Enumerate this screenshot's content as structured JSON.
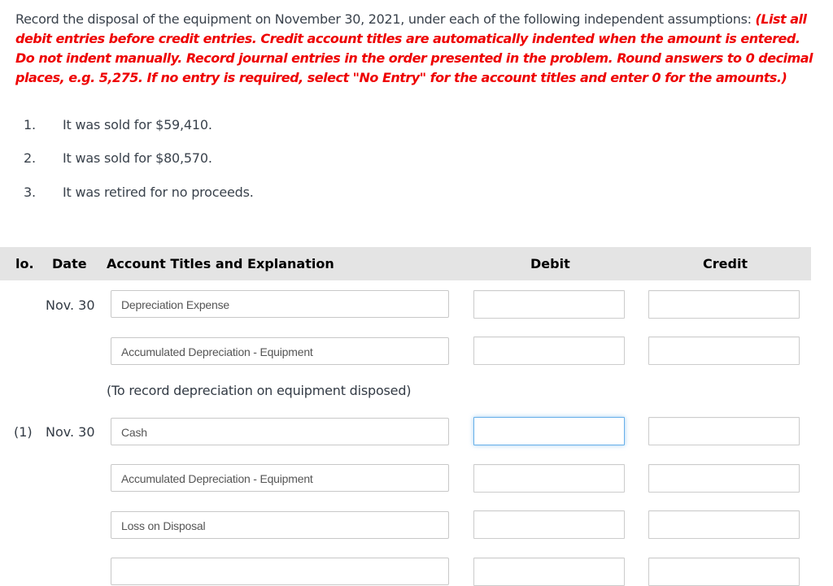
{
  "instructions": {
    "intro": "Record the disposal of the equipment on November 30, 2021, under each of the following independent assumptions: ",
    "note": "(List all debit entries before credit entries. Credit account titles are automatically indented when the amount is entered. Do not indent manually. Record journal entries in the order presented in the problem. Round answers to 0 decimal places, e.g. 5,275. If no entry is required, select \"No Entry\" for the account titles and enter 0 for the amounts.)"
  },
  "assumptions": [
    {
      "number": "1.",
      "text": "It was sold for $59,410."
    },
    {
      "number": "2.",
      "text": "It was sold for $80,570."
    },
    {
      "number": "3.",
      "text": "It was retired for no proceeds."
    }
  ],
  "table": {
    "headers": {
      "no": "lo.",
      "date": "Date",
      "account": "Account Titles and Explanation",
      "debit": "Debit",
      "credit": "Credit"
    },
    "entries": [
      {
        "no": "",
        "date": "Nov. 30",
        "lines": [
          {
            "account": "Depreciation Expense",
            "debit": "",
            "credit": ""
          },
          {
            "account": "Accumulated Depreciation - Equipment",
            "debit": "",
            "credit": ""
          }
        ],
        "explanation": "(To record depreciation on equipment disposed)"
      },
      {
        "no": "(1)",
        "date": "Nov. 30",
        "lines": [
          {
            "account": "Cash",
            "debit": "",
            "credit": ""
          },
          {
            "account": "Accumulated Depreciation - Equipment",
            "debit": "",
            "credit": ""
          },
          {
            "account": "Loss on Disposal",
            "debit": "",
            "credit": ""
          },
          {
            "account": "",
            "debit": "",
            "credit": ""
          }
        ]
      }
    ]
  },
  "colors": {
    "instruction_red": "#ee0000",
    "header_bg": "#e4e4e4",
    "focus_border": "#66afe9"
  }
}
